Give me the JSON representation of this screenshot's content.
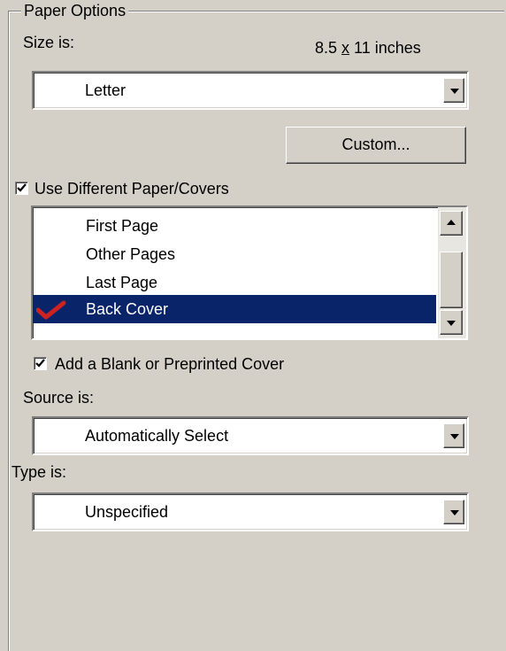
{
  "group": {
    "title": "Paper Options"
  },
  "size": {
    "label": "Size is:",
    "dimensions": "8.5 x 11 inches",
    "dimensions_pre": "8.5 ",
    "dimensions_x": "x",
    "dimensions_post": " 11 inches",
    "value": "Letter"
  },
  "custom_button": "Custom...",
  "use_different": {
    "label": "Use Different Paper/Covers",
    "checked": true
  },
  "pages_list": {
    "items": [
      {
        "label": "First Page",
        "checked": false,
        "selected": false
      },
      {
        "label": "Other Pages",
        "checked": false,
        "selected": false
      },
      {
        "label": "Last Page",
        "checked": false,
        "selected": false
      },
      {
        "label": "Back Cover",
        "checked": true,
        "selected": true
      }
    ]
  },
  "blank_cover": {
    "label": "Add a Blank or Preprinted Cover",
    "checked": true
  },
  "source": {
    "label": "Source is:",
    "value": "Automatically Select"
  },
  "type": {
    "label": "Type is:",
    "value": "Unspecified"
  },
  "colors": {
    "face": "#d4d0c8",
    "selection": "#0a246a",
    "checkmark": "#cc2222"
  }
}
